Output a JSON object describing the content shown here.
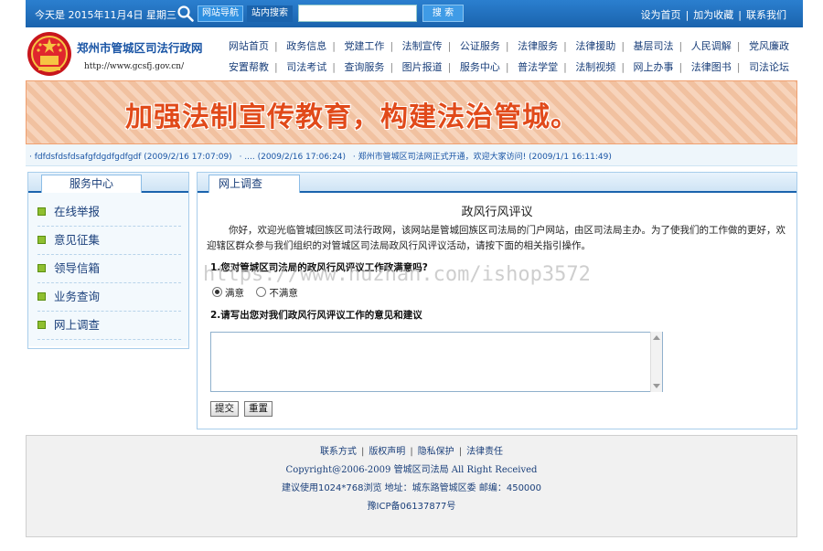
{
  "topbar": {
    "date_text": "今天是  2015年11月4日  星期三",
    "nav_button": "网站导航",
    "site_search_button": "站内搜索",
    "search_placeholder": "",
    "search_button": "搜  索",
    "links": [
      "设为首页",
      "加为收藏",
      "联系我们"
    ]
  },
  "header": {
    "site_title": "郑州市管城区司法行政网",
    "site_url": "http://www.gcsfj.gov.cn/",
    "nav_row1": [
      "网站首页",
      "政务信息",
      "党建工作",
      "法制宣传",
      "公证服务",
      "法律服务",
      "法律援助",
      "基层司法",
      "人民调解",
      "党风廉政"
    ],
    "nav_row2": [
      "安置帮教",
      "司法考试",
      "查询服务",
      "图片报道",
      "服务中心",
      "普法学堂",
      "法制视频",
      "网上办事",
      "法律图书",
      "司法论坛"
    ]
  },
  "banner": {
    "slogan": "加强法制宣传教育，构建法治管城。"
  },
  "ticker": {
    "items": [
      "· fdfdsfdsfdsafgfdgdfgdfgdf (2009/2/16 17:07:09)",
      "· .... (2009/2/16 17:06:24)",
      "· 郑州市管城区司法网正式开通，欢迎大家访问! (2009/1/1 16:11:49)"
    ]
  },
  "sidebar": {
    "title": "服务中心",
    "items": [
      "在线举报",
      "意见征集",
      "领导信箱",
      "业务查询",
      "网上调查"
    ]
  },
  "main": {
    "tab_title": "网上调查",
    "survey_title": "政风行风评议",
    "intro": "你好，欢迎光临管城回族区司法行政网，该网站是管城回族区司法局的门户网站，由区司法局主办。为了使我们的工作做的更好，欢迎辖区群众参与我们组织的对管城区司法局政风行风评议活动，请按下面的相关指引操作。",
    "q1": "1.您对管城区司法局的政风行风评议工作政满意吗?",
    "q1_options": [
      "满意",
      "不满意"
    ],
    "q1_selected": "满意",
    "q2": "2.请写出您对我们政风行风评议工作的意见和建议",
    "comment_value": "",
    "submit_label": "提交",
    "reset_label": "重置"
  },
  "watermark": "https://www.huzhan.com/ishop3572",
  "footer": {
    "links": [
      "联系方式",
      "版权声明",
      "隐私保护",
      "法律责任"
    ],
    "copyright": "Copyright@2006-2009  管城区司法局  All Right Received",
    "address": "建议使用1024*768浏览  地址：城东路管城区委  邮编：450000",
    "icp": "豫ICP备06137877号"
  },
  "colors": {
    "topbar_blue": "#1a63ad",
    "banner_slogan": "#e14a1a",
    "link_blue": "#1a3f7a"
  }
}
